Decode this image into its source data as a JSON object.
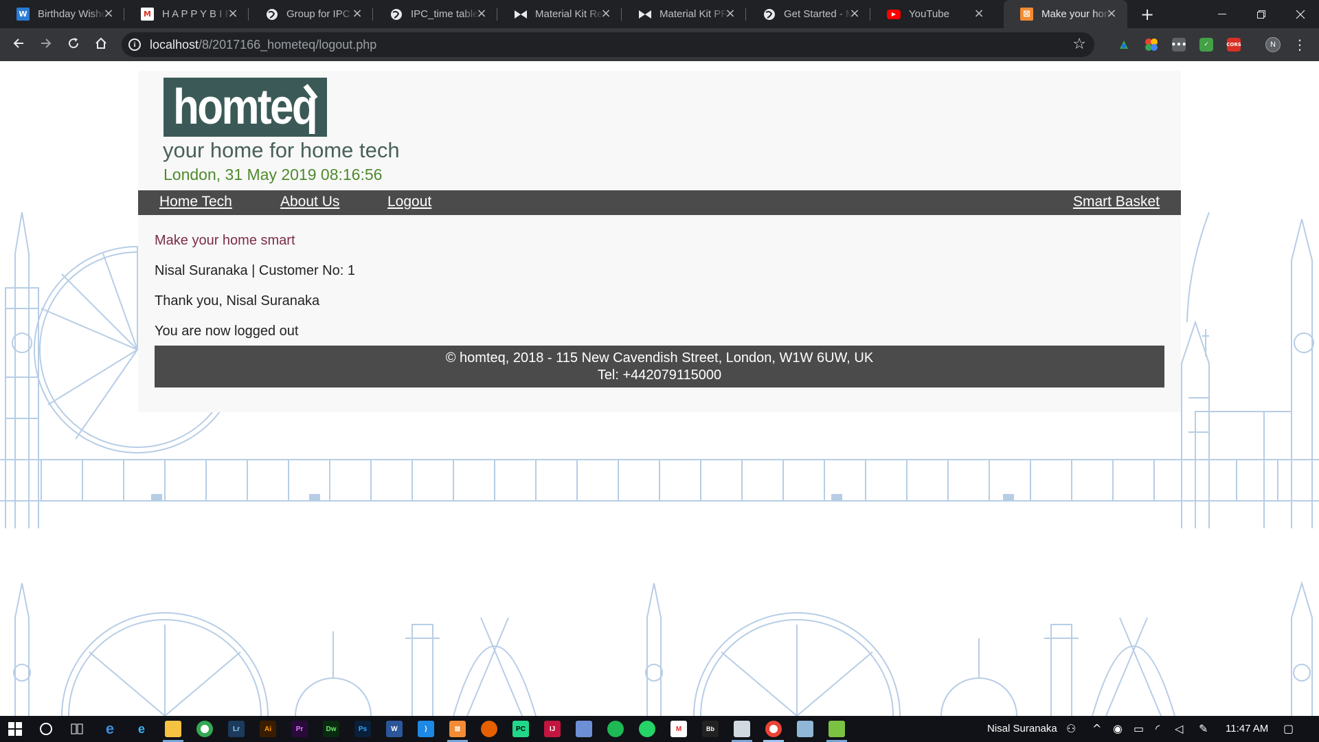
{
  "browser": {
    "tabs": [
      {
        "title": "Birthday Wishes",
        "favicon": "W",
        "favicon_color": "#2b7bd4",
        "active": false
      },
      {
        "title": "H A P P Y B I R T H D A Y",
        "favicon": "M",
        "favicon_color": "#d93025",
        "active": false
      },
      {
        "title": "Group for IPC S",
        "favicon": "globe",
        "favicon_color": "#bdc1c6",
        "active": false
      },
      {
        "title": "IPC_time table",
        "favicon": "globe",
        "favicon_color": "#bdc1c6",
        "active": false
      },
      {
        "title": "Material Kit React",
        "favicon": "bow",
        "favicon_color": "#111111",
        "active": false
      },
      {
        "title": "Material Kit PRO",
        "favicon": "bow",
        "favicon_color": "#111111",
        "active": false
      },
      {
        "title": "Get Started - M",
        "favicon": "globe",
        "favicon_color": "#bdc1c6",
        "active": false
      },
      {
        "title": "YouTube",
        "favicon": "▶",
        "favicon_color": "#ff0000",
        "active": false
      },
      {
        "title": "Make your home smart",
        "favicon": "⊠",
        "favicon_color": "#f28b33",
        "active": true
      }
    ],
    "url_host": "localhost",
    "url_path": "/8/2017166_hometeq/logout.php"
  },
  "site": {
    "logo_text": "homteq",
    "tagline": "your home for home tech",
    "dateline": "London, 31 May 2019 08:16:56",
    "nav": {
      "home_tech": "Home Tech",
      "about_us": "About Us",
      "logout": "Logout",
      "smart_basket": "Smart Basket"
    },
    "heading": "Make your home smart",
    "customer_line": "Nisal Suranaka | Customer No: 1",
    "thanks_line": "Thank you, Nisal Suranaka",
    "logout_line": "You are now logged out",
    "footer_line1": "© homteq, 2018 - 115 New Cavendish Street, London, W1W 6UW, UK",
    "footer_line2": "Tel: +442079115000"
  },
  "taskbar": {
    "user_name": "Nisal Suranaka",
    "clock": "11:47 AM"
  },
  "colors": {
    "logo_bg": "#3b5a57",
    "tagline": "#48605a",
    "dateline": "#4e8a2c",
    "heading": "#7a2d45",
    "nav_bg": "#4b4b4b",
    "skyline": "#b7cde6"
  }
}
